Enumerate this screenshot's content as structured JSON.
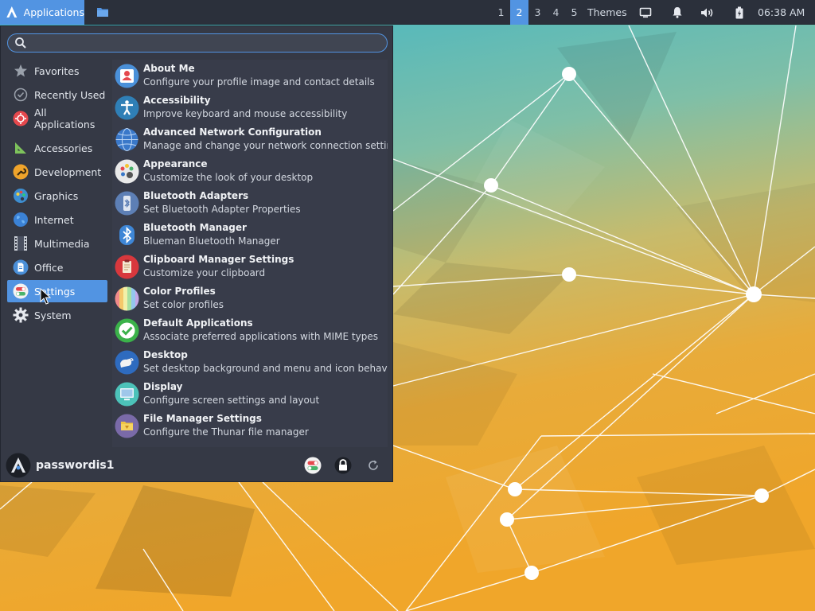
{
  "panel": {
    "apps_label": "Applications",
    "workspaces": [
      "1",
      "2",
      "3",
      "4",
      "5"
    ],
    "active_workspace": "2",
    "themes_label": "Themes",
    "clock": "06:38 AM",
    "accent_color": "#5294e2"
  },
  "menu": {
    "search": {
      "value": "",
      "placeholder": ""
    },
    "categories": [
      {
        "label": "Favorites",
        "icon": "star-icon"
      },
      {
        "label": "Recently Used",
        "icon": "clock-icon"
      },
      {
        "label": "All Applications",
        "icon": "all-apps-icon"
      },
      {
        "label": "Accessories",
        "icon": "ruler-icon"
      },
      {
        "label": "Development",
        "icon": "wrench-icon"
      },
      {
        "label": "Graphics",
        "icon": "palette-icon"
      },
      {
        "label": "Internet",
        "icon": "globe-icon"
      },
      {
        "label": "Multimedia",
        "icon": "film-icon"
      },
      {
        "label": "Office",
        "icon": "document-icon"
      },
      {
        "label": "Settings",
        "icon": "settings-toggle-icon",
        "selected": true
      },
      {
        "label": "System",
        "icon": "gear-icon"
      }
    ],
    "apps": [
      {
        "name": "About Me",
        "desc": "Configure your profile image and contact details",
        "icon": "user-card-icon"
      },
      {
        "name": "Accessibility",
        "desc": "Improve keyboard and mouse accessibility",
        "icon": "accessibility-icon"
      },
      {
        "name": "Advanced Network Configuration",
        "desc": "Manage and change your network connection settings",
        "icon": "network-globe-icon"
      },
      {
        "name": "Appearance",
        "desc": "Customize the look of your desktop",
        "icon": "appearance-palette-icon"
      },
      {
        "name": "Bluetooth Adapters",
        "desc": "Set Bluetooth Adapter Properties",
        "icon": "bluetooth-adapter-icon"
      },
      {
        "name": "Bluetooth Manager",
        "desc": "Blueman Bluetooth Manager",
        "icon": "bluetooth-icon"
      },
      {
        "name": "Clipboard Manager Settings",
        "desc": "Customize your clipboard",
        "icon": "clipboard-icon"
      },
      {
        "name": "Color Profiles",
        "desc": "Set color profiles",
        "icon": "color-profiles-icon"
      },
      {
        "name": "Default Applications",
        "desc": "Associate preferred applications with MIME types",
        "icon": "checkmark-icon"
      },
      {
        "name": "Desktop",
        "desc": "Set desktop background and menu and icon behavior",
        "icon": "desktop-mouse-icon"
      },
      {
        "name": "Display",
        "desc": "Configure screen settings and layout",
        "icon": "display-icon"
      },
      {
        "name": "File Manager Settings",
        "desc": "Configure the Thunar file manager",
        "icon": "file-manager-icon"
      }
    ],
    "user": {
      "name": "passwordis1"
    }
  }
}
